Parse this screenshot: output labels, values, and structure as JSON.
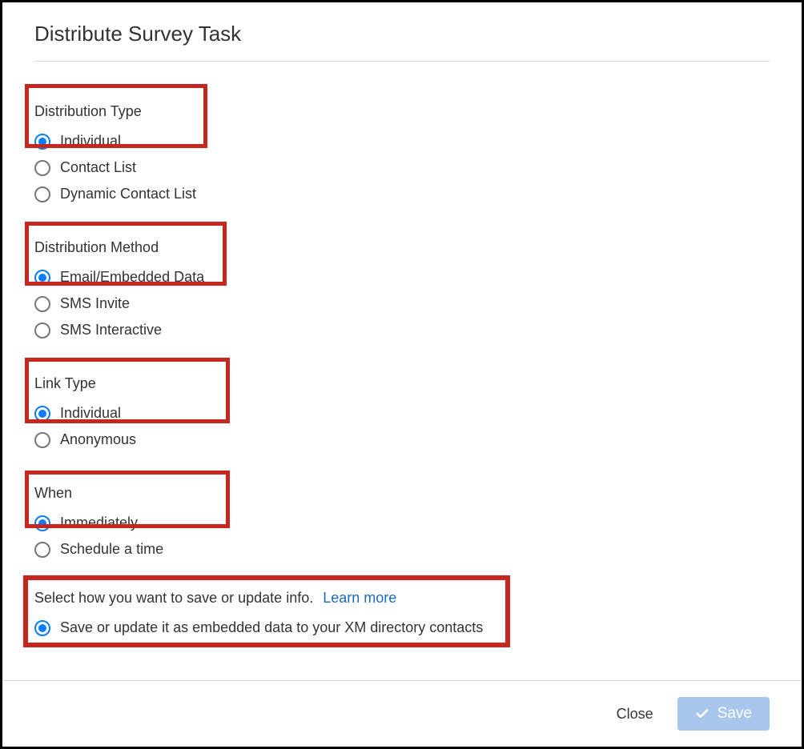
{
  "title": "Distribute Survey Task",
  "sections": {
    "distribution_type": {
      "label": "Distribution Type",
      "options": [
        {
          "label": "Individual",
          "selected": true
        },
        {
          "label": "Contact List",
          "selected": false
        },
        {
          "label": "Dynamic Contact List",
          "selected": false
        }
      ]
    },
    "distribution_method": {
      "label": "Distribution Method",
      "options": [
        {
          "label": "Email/Embedded Data",
          "selected": true
        },
        {
          "label": "SMS Invite",
          "selected": false
        },
        {
          "label": "SMS Interactive",
          "selected": false
        }
      ]
    },
    "link_type": {
      "label": "Link Type",
      "options": [
        {
          "label": "Individual",
          "selected": true
        },
        {
          "label": "Anonymous",
          "selected": false
        }
      ]
    },
    "when": {
      "label": "When",
      "options": [
        {
          "label": "Immediately",
          "selected": true
        },
        {
          "label": "Schedule a time",
          "selected": false
        }
      ]
    },
    "save_info": {
      "label": "Select how you want to save or update info.",
      "learn_more": "Learn more",
      "options": [
        {
          "label": "Save or update it as embedded data to your XM directory contacts",
          "selected": true
        }
      ]
    }
  },
  "footer": {
    "close": "Close",
    "save": "Save"
  }
}
